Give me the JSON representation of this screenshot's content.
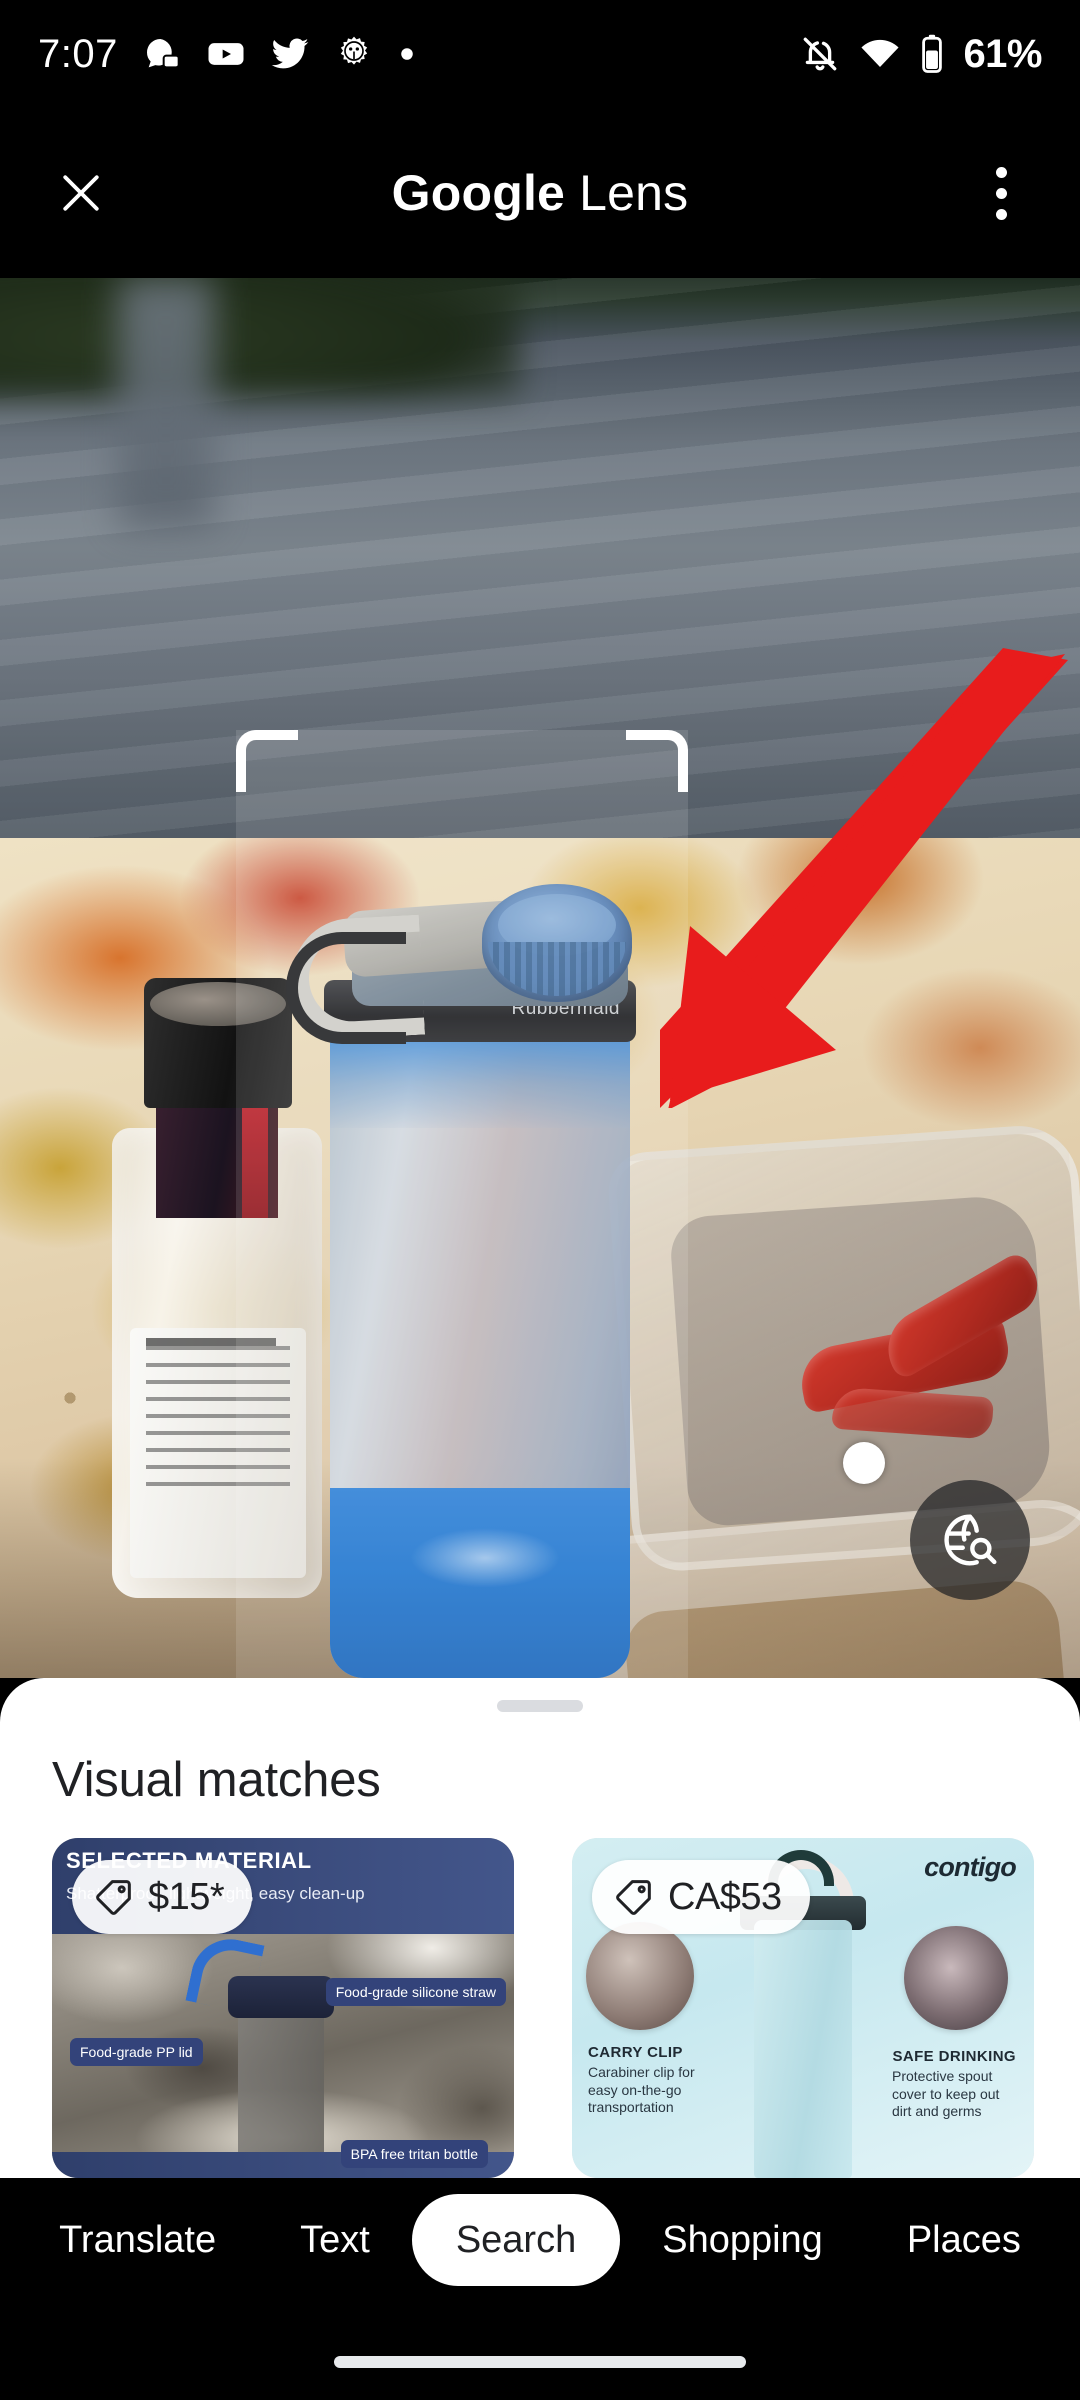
{
  "status_bar": {
    "time": "7:07",
    "battery_percent": "61%",
    "left_icons": [
      "chat-bubble-icon",
      "youtube-icon",
      "twitter-icon",
      "android-gear-icon",
      "dot-icon"
    ],
    "right_icons": [
      "notifications-off-icon",
      "wifi-icon",
      "battery-icon"
    ]
  },
  "app_bar": {
    "title_bold": "Google",
    "title_light": "Lens",
    "close_icon": "close-icon",
    "overflow_icon": "more-vert-icon"
  },
  "viewport": {
    "selection_frame": "object-selection-frame",
    "object_dot": "detected-object-dot",
    "globe_search_icon": "globe-search-icon",
    "annotation_arrow": "red-arrow-annotation",
    "bottle_brand_text": "Rubbermaid"
  },
  "sheet": {
    "handle": "drag-handle",
    "title": "Visual matches",
    "cards": [
      {
        "price": "$15*",
        "price_icon": "price-tag-icon",
        "headline": "SELECTED MATERIAL",
        "subhead": "Shatterproof, lightweight, easy clean-up",
        "labels": [
          "Food-grade silicone straw",
          "Food-grade PP lid",
          "BPA free tritan bottle"
        ]
      },
      {
        "price": "CA$53",
        "price_icon": "price-tag-icon",
        "brand": "contigo",
        "features": [
          {
            "title": "CARRY CLIP",
            "desc": "Carabiner clip for easy on-the-go transportation"
          },
          {
            "title": "SAFE DRINKING",
            "desc": "Protective spout cover to keep out dirt and germs"
          }
        ]
      }
    ]
  },
  "tab_bar": {
    "tabs": [
      {
        "label": "Translate",
        "active": false
      },
      {
        "label": "Text",
        "active": false
      },
      {
        "label": "Search",
        "active": true
      },
      {
        "label": "Shopping",
        "active": false
      },
      {
        "label": "Places",
        "active": false
      }
    ]
  },
  "colors": {
    "accent_red": "#e81c1c",
    "sheet_bg": "#ffffff",
    "bar_bg": "#000000",
    "text_primary": "#202124"
  }
}
